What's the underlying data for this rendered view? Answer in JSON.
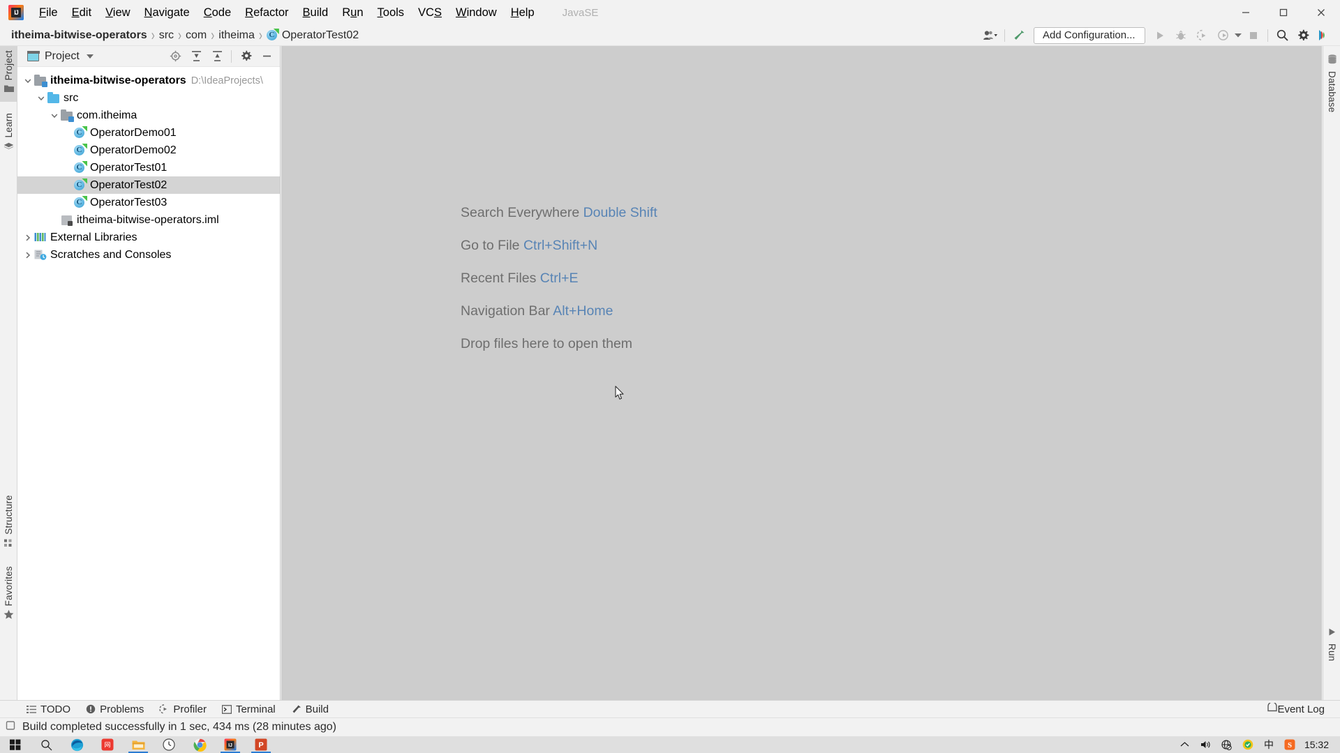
{
  "menu": {
    "items": [
      {
        "label": "File",
        "mnemonic": "F"
      },
      {
        "label": "Edit",
        "mnemonic": "E"
      },
      {
        "label": "View",
        "mnemonic": "V"
      },
      {
        "label": "Navigate",
        "mnemonic": "N"
      },
      {
        "label": "Code",
        "mnemonic": "C"
      },
      {
        "label": "Refactor",
        "mnemonic": "R"
      },
      {
        "label": "Build",
        "mnemonic": "B"
      },
      {
        "label": "Run",
        "mnemonic": "u"
      },
      {
        "label": "Tools",
        "mnemonic": "T"
      },
      {
        "label": "VCS",
        "mnemonic": "S"
      },
      {
        "label": "Window",
        "mnemonic": "W"
      },
      {
        "label": "Help",
        "mnemonic": "H"
      }
    ],
    "project_label": "JavaSE",
    "logo_text": "IJ"
  },
  "window_controls": {
    "minimize": "minimize-icon",
    "maximize": "maximize-icon",
    "close": "close-icon"
  },
  "navbar": {
    "breadcrumbs": [
      {
        "label": "itheima-bitwise-operators",
        "bold": true,
        "icon": null
      },
      {
        "label": "src",
        "bold": false,
        "icon": null
      },
      {
        "label": "com",
        "bold": false,
        "icon": null
      },
      {
        "label": "itheima",
        "bold": false,
        "icon": null
      },
      {
        "label": "OperatorTest02",
        "bold": false,
        "icon": "java-class-icon"
      }
    ],
    "separator": "›",
    "add_configuration_label": "Add Configuration...",
    "icons": [
      "user-dropdown-icon",
      "build-hammer-icon",
      "run-icon",
      "debug-icon",
      "run-with-coverage-icon",
      "profiler-dropdown-icon",
      "stop-icon",
      "search-icon",
      "settings-gear-icon",
      "ide-assistant-icon"
    ]
  },
  "left_stripe": {
    "top_tabs": [
      {
        "label": "Project",
        "icon": "folder-icon",
        "active": true
      },
      {
        "label": "Learn",
        "icon": "books-icon",
        "active": false
      }
    ],
    "bottom_tabs": [
      {
        "label": "Structure",
        "icon": "structure-icon",
        "active": false
      },
      {
        "label": "Favorites",
        "icon": "star-icon",
        "active": false
      }
    ]
  },
  "right_stripe": {
    "top_tabs": [
      {
        "label": "Database",
        "icon": "database-icon",
        "active": false
      }
    ],
    "bottom_tabs": [
      {
        "label": "Run",
        "icon": "run-triangle-icon",
        "active": false
      }
    ]
  },
  "project_panel": {
    "title": "Project",
    "header_icons": [
      "target-locate-icon",
      "expand-all-icon",
      "collapse-all-icon",
      "settings-gear-icon",
      "hide-minimize-icon"
    ],
    "tree": [
      {
        "label": "itheima-bitwise-operators",
        "path": "D:\\IdeaProjects\\",
        "indent": 0,
        "twisty": "down",
        "icon": "project-folder-icon",
        "bold": true,
        "selected": false
      },
      {
        "label": "src",
        "path": "",
        "indent": 1,
        "twisty": "down",
        "icon": "source-folder-icon",
        "bold": false,
        "selected": false
      },
      {
        "label": "com.itheima",
        "path": "",
        "indent": 2,
        "twisty": "down",
        "icon": "package-icon",
        "bold": false,
        "selected": false
      },
      {
        "label": "OperatorDemo01",
        "path": "",
        "indent": 3,
        "twisty": "none",
        "icon": "java-class-icon",
        "bold": false,
        "selected": false
      },
      {
        "label": "OperatorDemo02",
        "path": "",
        "indent": 3,
        "twisty": "none",
        "icon": "java-class-icon",
        "bold": false,
        "selected": false
      },
      {
        "label": "OperatorTest01",
        "path": "",
        "indent": 3,
        "twisty": "none",
        "icon": "java-class-icon",
        "bold": false,
        "selected": false
      },
      {
        "label": "OperatorTest02",
        "path": "",
        "indent": 3,
        "twisty": "none",
        "icon": "java-class-icon",
        "bold": false,
        "selected": true
      },
      {
        "label": "OperatorTest03",
        "path": "",
        "indent": 3,
        "twisty": "none",
        "icon": "java-class-icon",
        "bold": false,
        "selected": false
      },
      {
        "label": "itheima-bitwise-operators.iml",
        "path": "",
        "indent": 2,
        "twisty": "none",
        "icon": "iml-file-icon",
        "bold": false,
        "selected": false
      },
      {
        "label": "External Libraries",
        "path": "",
        "indent": 0,
        "twisty": "right",
        "icon": "libraries-icon",
        "bold": false,
        "selected": false
      },
      {
        "label": "Scratches and Consoles",
        "path": "",
        "indent": 0,
        "twisty": "right",
        "icon": "scratches-icon",
        "bold": false,
        "selected": false
      }
    ]
  },
  "editor": {
    "hints": [
      {
        "text": "Search Everywhere",
        "key": "Double Shift"
      },
      {
        "text": "Go to File",
        "key": "Ctrl+Shift+N"
      },
      {
        "text": "Recent Files",
        "key": "Ctrl+E"
      },
      {
        "text": "Navigation Bar",
        "key": "Alt+Home"
      },
      {
        "text": "Drop files here to open them",
        "key": ""
      }
    ],
    "background_color": "#cdcdcd",
    "hint_color": "#6e6e6e",
    "hint_key_color": "#5884b5"
  },
  "bottom_tool_tabs": [
    {
      "label": "TODO",
      "icon": "todo-list-icon"
    },
    {
      "label": "Problems",
      "icon": "problems-warning-icon"
    },
    {
      "label": "Profiler",
      "icon": "profiler-icon"
    },
    {
      "label": "Terminal",
      "icon": "terminal-icon"
    },
    {
      "label": "Build",
      "icon": "build-hammer-icon"
    }
  ],
  "event_log": {
    "label": "Event Log",
    "icon": "event-log-icon"
  },
  "status_bar": {
    "icon": "build-status-icon",
    "message": "Build completed successfully in 1 sec, 434 ms (28 minutes ago)"
  },
  "taskbar": {
    "items": [
      {
        "name": "windows-start-icon",
        "running": false
      },
      {
        "name": "search-icon",
        "running": false
      },
      {
        "name": "microsoft-edge-icon",
        "running": false
      },
      {
        "name": "app-red-icon",
        "running": false
      },
      {
        "name": "file-explorer-icon",
        "running": true
      },
      {
        "name": "clock-app-icon",
        "running": false
      },
      {
        "name": "google-chrome-icon",
        "running": false
      },
      {
        "name": "intellij-idea-icon",
        "running": true
      },
      {
        "name": "powerpoint-icon",
        "running": true
      }
    ],
    "tray": [
      {
        "name": "show-hidden-icons-chevron"
      },
      {
        "name": "volume-icon"
      },
      {
        "name": "network-disconnected-icon"
      },
      {
        "name": "update-app-icon"
      },
      {
        "name": "ime-chinese-icon",
        "glyph": "中"
      },
      {
        "name": "sogou-input-icon",
        "glyph": "S"
      }
    ],
    "clock": "15:32"
  }
}
